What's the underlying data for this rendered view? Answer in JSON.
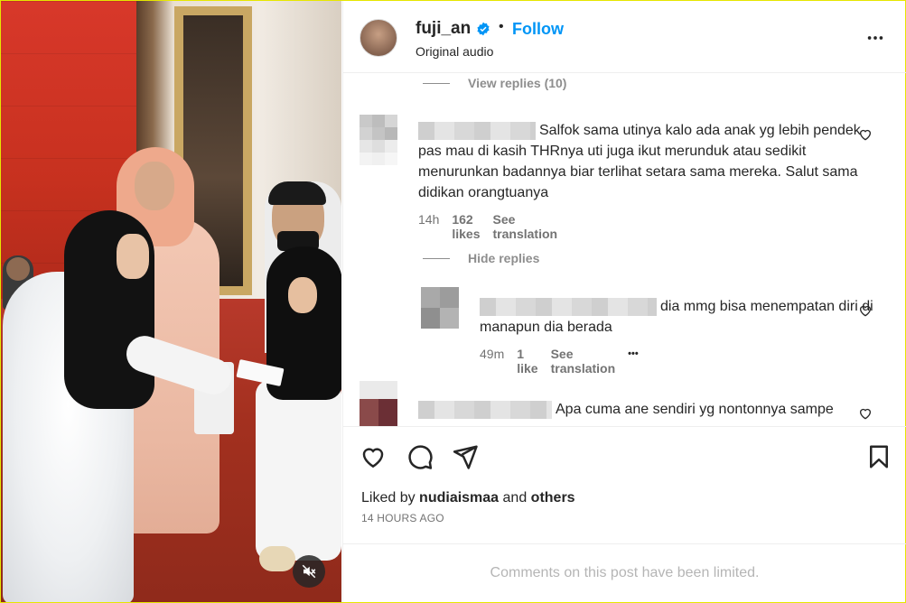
{
  "post": {
    "username": "fuji_an",
    "dot": "•",
    "follow_label": "Follow",
    "audio": "Original audio"
  },
  "thread": {
    "view_replies": "View replies (10)",
    "hide_replies": "Hide replies"
  },
  "comments": [
    {
      "text": "Salfok sama utinya kalo ada anak yg lebih pendek pas mau di kasih THRnya uti juga ikut merunduk atau sedikit menurunkan badannya biar terlihat setara sama mereka. Salut sama didikan orangtuanya",
      "time": "14h",
      "likes": "162 likes",
      "translate": "See translation"
    },
    {
      "text": "dia mmg bisa menempatan diri di manapun dia berada",
      "time": "49m",
      "likes": "1 like",
      "translate": "See translation",
      "more": "•••"
    },
    {
      "text": "Apa cuma ane sendiri yg nontonnya sampe"
    }
  ],
  "likes": {
    "prefix": "Liked by ",
    "user": "nudiaismaa",
    "and": " and ",
    "others": "others"
  },
  "timestamp": "14 HOURS AGO",
  "footer": "Comments on this post have been limited.",
  "colors": {
    "follow": "#0095f6",
    "verified": "#0095f6",
    "muted_text": "#737373",
    "divider": "#efefef"
  },
  "icons": [
    "mute-icon",
    "verified-icon",
    "more-icon",
    "heart-icon",
    "comment-icon",
    "share-icon",
    "bookmark-icon"
  ]
}
